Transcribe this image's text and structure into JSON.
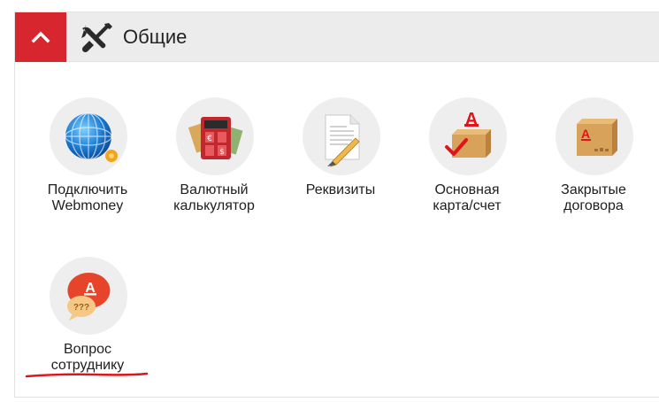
{
  "section": {
    "title": "Общие",
    "collapse_icon": "chevron-up-icon",
    "title_icon": "tools-icon",
    "accent_color": "#d7262d"
  },
  "tiles": [
    {
      "label_line1": "Подключить",
      "label_line2": "Webmoney",
      "icon": "webmoney-icon"
    },
    {
      "label_line1": "Валютный",
      "label_line2": "калькулятор",
      "icon": "currency-calculator-icon"
    },
    {
      "label_line1": "Реквизиты",
      "label_line2": "",
      "icon": "document-pen-icon"
    },
    {
      "label_line1": "Основная",
      "label_line2": "карта/счет",
      "icon": "box-check-icon"
    },
    {
      "label_line1": "Закрытые",
      "label_line2": "договора",
      "icon": "closed-box-icon"
    },
    {
      "label_line1": "Вопрос",
      "label_line2": "сотруднику",
      "icon": "question-bubble-icon"
    }
  ],
  "highlight": {
    "color": "#e0141b"
  }
}
